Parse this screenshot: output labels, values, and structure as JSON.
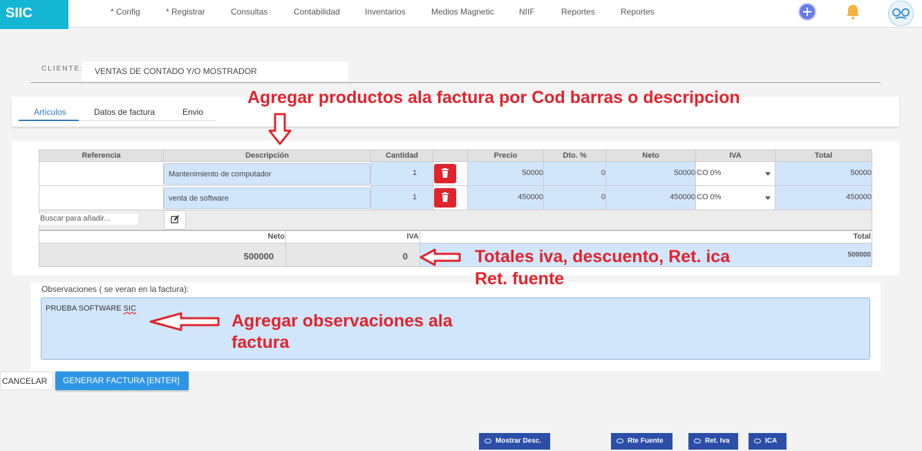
{
  "nav": {
    "brand": "SIIC",
    "items": [
      "* Config",
      "* Registrar",
      "Consultas",
      "Contabilidad",
      "Inventarios",
      "Medios Magnetic",
      "NIIF",
      "Reportes",
      "Reportes"
    ],
    "icons": [
      "plus-circle-icon",
      "bell-icon",
      "avatar-icon"
    ]
  },
  "cliente": {
    "label": "CLIENTE:",
    "value": "VENTAS DE CONTADO Y/O MOSTRADOR"
  },
  "tabs": [
    {
      "label": "Artículos",
      "active": true
    },
    {
      "label": "Datos de factura",
      "active": false
    },
    {
      "label": "Envio",
      "active": false
    }
  ],
  "table": {
    "headers": [
      "Referencia",
      "Descripción",
      "Cantidad",
      "",
      "Precio",
      "Dto. %",
      "Neto",
      "IVA",
      "Total"
    ],
    "rows": [
      {
        "referencia": "",
        "descripcion": "Mantenimiento de computador",
        "cantidad": "1",
        "precio": "50000",
        "dto": "0",
        "neto": "50000",
        "iva": "CO 0%",
        "total": "50000"
      },
      {
        "referencia": "",
        "descripcion": "venta de software",
        "cantidad": "1",
        "precio": "450000",
        "dto": "0",
        "neto": "450000",
        "iva": "CO 0%",
        "total": "450000"
      }
    ],
    "search_placeholder": "Buscar para añadir...",
    "totals": {
      "headers": [
        "Neto",
        "IVA",
        "Total"
      ],
      "values": [
        "500000",
        "0",
        "500000"
      ]
    }
  },
  "observaciones": {
    "label": "Observaciones ( se veran en la factura):",
    "value_main": "PRUEBA SOFTWARE ",
    "value_flagged": "SIC"
  },
  "buttons": {
    "cancel": "CANCELAR",
    "generate": "GENERAR FACTURA [ENTER]",
    "bottom": [
      "Mostrar Desc.",
      "Rte Fuente",
      "Ret. Iva",
      "ICA"
    ]
  },
  "annotations": {
    "productos": "Agregar productos ala factura por Cod barras o descripcion",
    "totales_1": "Totales iva, descuento, Ret. ica",
    "totales_2": "Ret. fuente",
    "observaciones_1": "Agregar observaciones ala",
    "observaciones_2": "factura"
  },
  "colors": {
    "brand": "#14b6d4",
    "primary": "#2d95e6",
    "danger": "#e0242d",
    "annotation": "#e0242d",
    "bottom_buttons": "#2c4ea8",
    "field_blue": "#d2e6fb"
  }
}
